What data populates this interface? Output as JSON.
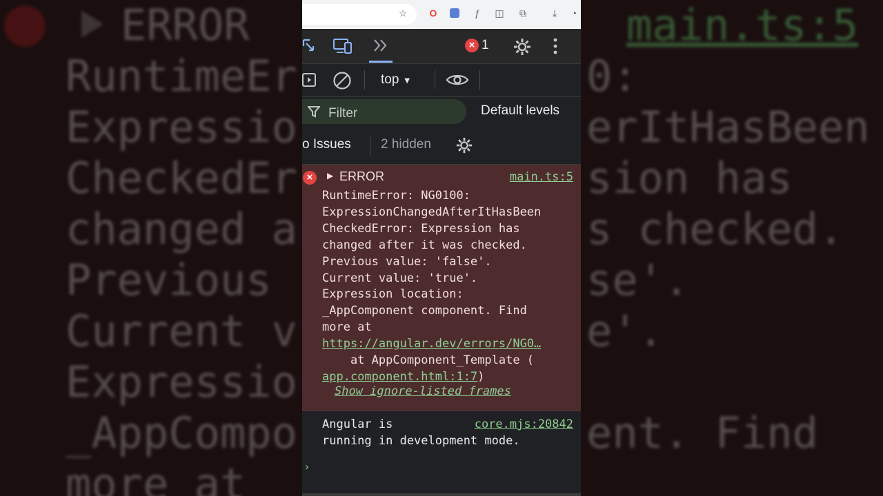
{
  "background": {
    "error_label": "ERROR",
    "lines": [
      "RuntimeEr",
      "Expressio",
      "CheckedEr",
      "changed a",
      "Previous",
      "Current v",
      "Expressio",
      "_AppCompo",
      "more at"
    ],
    "right_lines": [
      "0:",
      "erItHasBeen",
      "sion has",
      "s checked.",
      "se'.",
      "e'.",
      "",
      "ent. Find"
    ],
    "source_link": "main.ts:5"
  },
  "devtools": {
    "error_count": "1",
    "context": "top",
    "filter_placeholder": "Filter",
    "levels": "Default levels",
    "issues": "o Issues",
    "hidden": "2 hidden",
    "error": {
      "header": "ERROR",
      "source": "main.ts:5",
      "lines": [
        "RuntimeError: NG0100:",
        "ExpressionChangedAfterItHasBeen",
        "CheckedError: Expression has",
        "changed after it was checked.",
        "Previous value: 'false'.",
        "Current value: 'true'.",
        "Expression location:",
        "_AppComponent component. Find",
        "more at"
      ],
      "url": "https://angular.dev/errors/NG0…",
      "at_text": "    at AppComponent_Template (",
      "template_link": "app.component.html:1:7",
      "close_paren": ")",
      "ignore_frames": "Show ignore-listed frames"
    },
    "info": {
      "lines": [
        "Angular is",
        "running in development mode."
      ],
      "source": "core.mjs:20842"
    },
    "prompt": "›"
  },
  "colors": {
    "error_bg": "#4e2c2d",
    "link": "#8fcf93",
    "error_icon": "#e34343",
    "panel_bg": "#202124"
  }
}
